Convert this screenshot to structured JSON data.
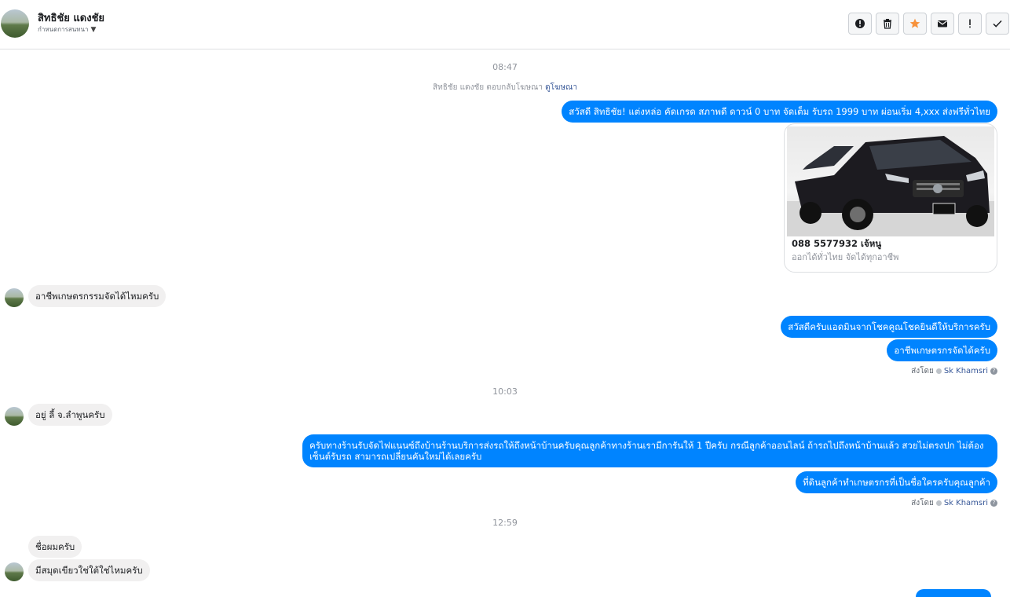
{
  "header": {
    "name": "สิทธิชัย แดงชัย",
    "subtitle": "กำหนดการสนทนา",
    "actions": [
      "mark-spam",
      "delete",
      "star",
      "envelope",
      "important",
      "done"
    ]
  },
  "times": [
    "08:47",
    "10:03",
    "12:59"
  ],
  "ad_note": {
    "text": "สิทธิชัย แดงชัย ตอบกลับโฆษณา",
    "link": "ดูโฆษณา"
  },
  "messages": {
    "m1": "สวัสดี สิทธิชัย! แต่งหล่อ คัดเกรด สภาพดี ดาวน์ 0 บาท จัดเต็ม รับรถ 1999 บาท ผ่อนเริ่ม 4,xxx ส่งฟรีทั่วไทย",
    "card_title": "088 5577932 เจ้หนู",
    "card_sub": "ออกได้ทั่วไทย จัดได้ทุกอาชีพ",
    "m2": "อาชีพเกษตรกรรมจัดได้ไหมครับ",
    "m3": "สวัสดีครับแอดมินจากโชคคูณโชคยินดีให้บริการครับ",
    "m4": "อาชีพเกษตรกรจัดได้ครับ",
    "m5": "อยู่ ลี้ จ.ลำพูนครับ",
    "m6": "ครับทางร้านรับจัดไฟแนนซ์ถึงบ้านร้านบริการส่งรถให้ถึงหน้าบ้านครับคุณลูกค้าทางร้านเรามีการันให้ 1 ปีครับ กรณีลูกค้าออนไลน์ ถ้ารถไปถึงหน้าบ้านแล้ว สวยไม่ตรงปก ไม่ต้องเซ็นต์รับรถ สามารถเปลี่ยนคันใหม่ได้เลยครับ",
    "m7": "ที่ดินลูกค้าทำเกษตรกรที่เป็นชื่อใครครับคุณลูกค้า",
    "m8": "ชื่อผมครับ",
    "m9": "มีสมุดเขียวใช่ใต้ใช่ไหมครับ"
  },
  "sent_by": {
    "prefix": "ส่งโดย",
    "who": "Sk Khamsri"
  }
}
